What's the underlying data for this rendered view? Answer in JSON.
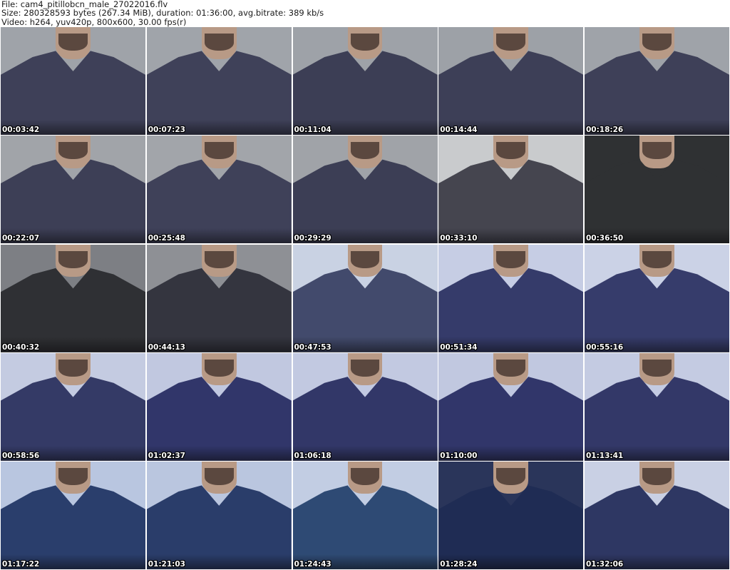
{
  "header": {
    "file_line": "File: cam4_pitillobcn_male_27022016.flv",
    "size_line": "Size: 280328593 bytes (267.34 MiB), duration: 01:36:00, avg.bitrate: 389 kb/s",
    "video_line": "Video: h264, yuv420p, 800x600, 30.00 fps(r)"
  },
  "thumbnails": [
    {
      "timestamp": "00:03:42",
      "shirt": "#3e4058",
      "bg": "#9fa3a9"
    },
    {
      "timestamp": "00:07:23",
      "shirt": "#3f4159",
      "bg": "#a0a4aa"
    },
    {
      "timestamp": "00:11:04",
      "shirt": "#3c3e55",
      "bg": "#9ea2a8"
    },
    {
      "timestamp": "00:14:44",
      "shirt": "#3d3f57",
      "bg": "#9da1a7"
    },
    {
      "timestamp": "00:18:26",
      "shirt": "#3e4058",
      "bg": "#9fa3a9"
    },
    {
      "timestamp": "00:22:07",
      "shirt": "#3d3f56",
      "bg": "#a1a4a9"
    },
    {
      "timestamp": "00:25:48",
      "shirt": "#3f4159",
      "bg": "#a2a5aa"
    },
    {
      "timestamp": "00:29:29",
      "shirt": "#3c3e55",
      "bg": "#a0a3a8"
    },
    {
      "timestamp": "00:33:10",
      "shirt": "#45454f",
      "bg": "#c9cbcd"
    },
    {
      "timestamp": "00:36:50",
      "shirt": "#2f3133",
      "bg": "#2f3133"
    },
    {
      "timestamp": "00:40:32",
      "shirt": "#2f3034",
      "bg": "#7d7f84"
    },
    {
      "timestamp": "00:44:13",
      "shirt": "#34353f",
      "bg": "#8e9095"
    },
    {
      "timestamp": "00:47:53",
      "shirt": "#424a6c",
      "bg": "#c9d2e3"
    },
    {
      "timestamp": "00:51:34",
      "shirt": "#353b6a",
      "bg": "#c6cde4"
    },
    {
      "timestamp": "00:55:16",
      "shirt": "#363c6b",
      "bg": "#cbd2e6"
    },
    {
      "timestamp": "00:58:56",
      "shirt": "#343a66",
      "bg": "#c4cbe1"
    },
    {
      "timestamp": "01:02:37",
      "shirt": "#31366a",
      "bg": "#c1c8e0"
    },
    {
      "timestamp": "01:06:18",
      "shirt": "#323768",
      "bg": "#c2c9e1"
    },
    {
      "timestamp": "01:10:00",
      "shirt": "#31366a",
      "bg": "#c1c8e0"
    },
    {
      "timestamp": "01:13:41",
      "shirt": "#333868",
      "bg": "#c4cbe2"
    },
    {
      "timestamp": "01:17:22",
      "shirt": "#2a3e6c",
      "bg": "#b9c6e0"
    },
    {
      "timestamp": "01:21:03",
      "shirt": "#2a3d6a",
      "bg": "#bac6df"
    },
    {
      "timestamp": "01:24:43",
      "shirt": "#2e4a74",
      "bg": "#c2cde3"
    },
    {
      "timestamp": "01:28:24",
      "shirt": "#1f2c54",
      "bg": "#2a355a"
    },
    {
      "timestamp": "01:32:06",
      "shirt": "#2e3763",
      "bg": "#c9d0e4"
    }
  ]
}
